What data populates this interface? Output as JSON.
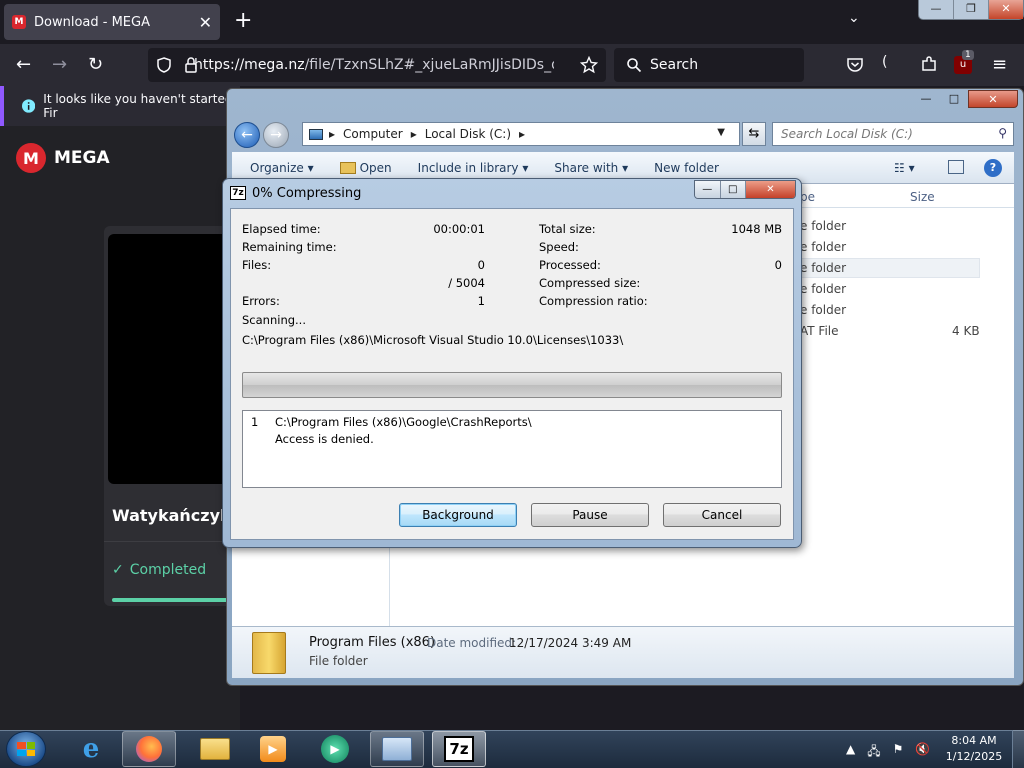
{
  "firefox": {
    "tab_title": "Download - MEGA",
    "tab_favicon_letter": "M",
    "tab_close": "✕",
    "new_tab": "+",
    "tab_list": "⌄",
    "url_host": "https://mega.nz",
    "url_path": "/file/TzxnSLhZ#_xjueLaRmJJisDIDs_dYjyHHP",
    "search_placeholder": "Search",
    "extension_badge": "1",
    "notification": "It looks like you haven't started Fir",
    "window_controls": [
      "—",
      "❐",
      "✕"
    ]
  },
  "mega": {
    "logo_letter": "M",
    "logo_text": "MEGA",
    "file_title": "Watykańczyk v",
    "status": "Completed",
    "progress": 1.0,
    "accent": "#5cd1a7",
    "brand_red": "#d9272e"
  },
  "explorer": {
    "breadcrumb": [
      "Computer",
      "Local Disk (C:)"
    ],
    "search_placeholder": "Search Local Disk (C:)",
    "toolbar": {
      "organize": "Organize ▾",
      "open": "Open",
      "include": "Include in library ▾",
      "share": "Share with ▾",
      "new_folder": "New folder"
    },
    "columns": {
      "type": "pe",
      "size": "Size"
    },
    "rows": [
      {
        "type": "e folder",
        "size": ""
      },
      {
        "type": "e folder",
        "size": ""
      },
      {
        "type": "e folder",
        "size": ""
      },
      {
        "type": "e folder",
        "size": ""
      },
      {
        "type": "e folder",
        "size": ""
      },
      {
        "type": "AT File",
        "size": "4 KB"
      }
    ],
    "details": {
      "name": "Program Files (x86)",
      "modified_label": "Date modified:",
      "modified": "12/17/2024 3:49 AM",
      "type": "File folder"
    },
    "window_controls": [
      "—",
      "□",
      "✕"
    ]
  },
  "sevenzip": {
    "icon_text": "7z",
    "title": "0% Compressing",
    "window_controls": [
      "—",
      "□",
      "✕"
    ],
    "elapsed_label": "Elapsed time:",
    "elapsed": "00:00:01",
    "remaining_label": "Remaining time:",
    "files_label": "Files:",
    "files": "0",
    "files_total": "/ 5004",
    "errors_label": "Errors:",
    "errors": "1",
    "total_size_label": "Total size:",
    "total_size": "1048 MB",
    "speed_label": "Speed:",
    "processed_label": "Processed:",
    "processed": "0",
    "compressed_label": "Compressed size:",
    "ratio_label": "Compression ratio:",
    "scanning": "Scanning...",
    "current_path": "C:\\Program Files (x86)\\Microsoft Visual Studio 10.0\\Licenses\\1033\\",
    "progress": 0,
    "log": [
      {
        "num": "1",
        "path": "C:\\Program Files (x86)\\Google\\CrashReports\\",
        "message": "Access is denied."
      }
    ],
    "buttons": {
      "background": "Background",
      "pause": "Pause",
      "cancel": "Cancel"
    }
  },
  "taskbar": {
    "time": "8:04 AM",
    "date": "1/12/2025",
    "apps": [
      "internet-explorer",
      "firefox",
      "file-explorer",
      "media-player",
      "media-center",
      "control-panel",
      "7-zip"
    ],
    "sevenzip_label": "7z"
  }
}
